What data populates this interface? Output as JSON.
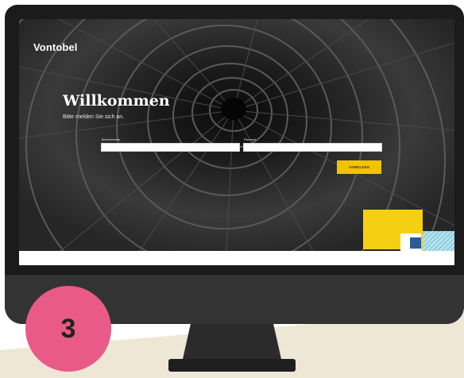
{
  "app": {
    "brand": "Vontobel"
  },
  "login": {
    "title": "Willkommen",
    "subtitle": "Bitte melden Sie sich an.",
    "username_label": "Benutzername",
    "password_label": "Passwort",
    "submit_label": "ANMELDEN"
  },
  "badge": {
    "number": "3",
    "color": "#e95a88"
  },
  "colors": {
    "accent": "#f2c300",
    "brand_blue": "#2a5d97",
    "teal": "#8ecde0"
  }
}
